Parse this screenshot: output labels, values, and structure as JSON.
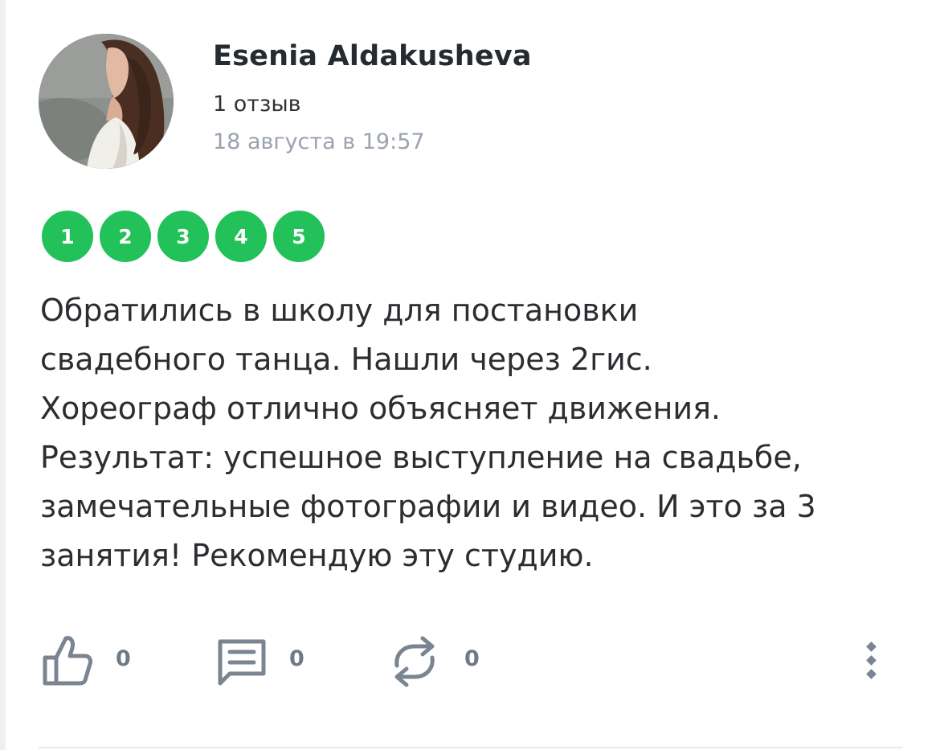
{
  "author": {
    "name": "Esenia Aldakusheva",
    "review_count": "1 отзыв",
    "date": "18 августа в 19:57"
  },
  "rating": {
    "value": 5,
    "max": 5,
    "labels": [
      "1",
      "2",
      "3",
      "4",
      "5"
    ],
    "color": "#22c15a"
  },
  "review": {
    "lines": [
      "Обратились в школу для постановки",
      "свадебного танца. Нашли через 2гис.",
      "Хореограф отлично объясняет движения.",
      "Результат: успешное выступление на свадьбе,",
      "замечательные фотографии и видео. И это за 3",
      "занятия! Рекомендую эту студию."
    ]
  },
  "actions": {
    "likes": "0",
    "comments": "0",
    "reposts": "0"
  },
  "icons": {
    "like": "thumbs-up-icon",
    "comment": "comment-icon",
    "repost": "repost-icon",
    "more": "more-vertical-icon"
  },
  "colors": {
    "icon": "#7b8592",
    "muted_text": "#9aa2ae"
  }
}
